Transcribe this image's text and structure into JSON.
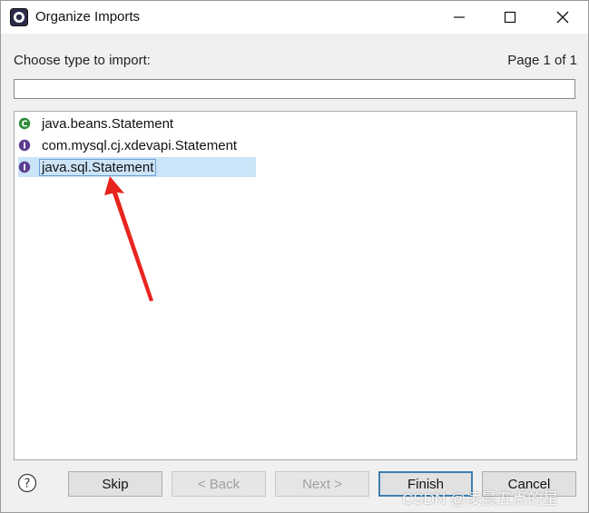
{
  "window": {
    "title": "Organize Imports"
  },
  "dialog": {
    "prompt_label": "Choose type to import:",
    "page_indicator": "Page 1 of 1",
    "filter_value": "",
    "types": [
      {
        "label": "java.beans.Statement",
        "icon": "class-icon",
        "selected": false
      },
      {
        "label": "com.mysql.cj.xdevapi.Statement",
        "icon": "interface-icon",
        "selected": false
      },
      {
        "label": "java.sql.Statement",
        "icon": "interface-icon",
        "selected": true
      }
    ]
  },
  "buttons": {
    "skip": "Skip",
    "back": "< Back",
    "next": "Next >",
    "finish": "Finish",
    "cancel": "Cancel"
  },
  "watermark": "CSDN @凌晨五点的星",
  "colors": {
    "selection": "#cce4f7",
    "class_icon": "#2e8b3a",
    "interface_icon": "#5a3d91",
    "annotation_arrow": "#e8241f"
  }
}
